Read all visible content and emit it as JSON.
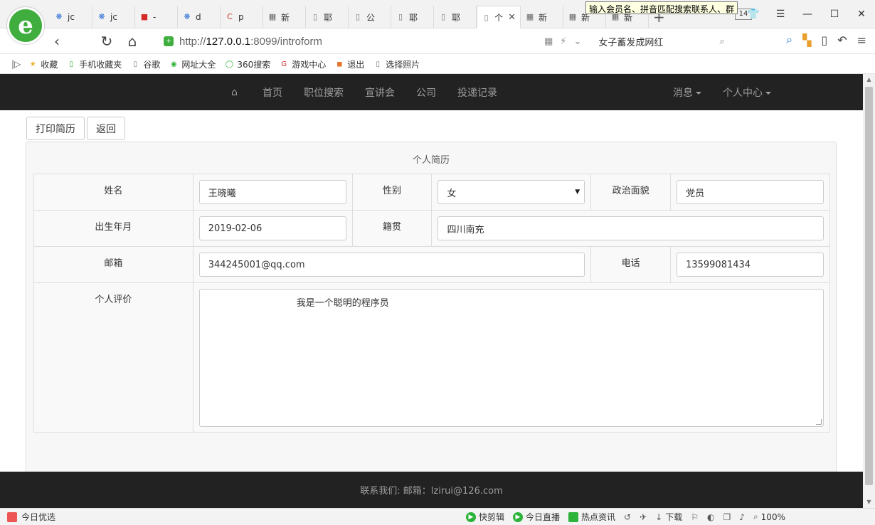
{
  "browser": {
    "logo_letter": "e",
    "tabs": [
      {
        "icon": "baidu-paw",
        "title": "jc"
      },
      {
        "icon": "baidu-paw",
        "title": "jc"
      },
      {
        "icon": "flag",
        "title": "-"
      },
      {
        "icon": "baidu-paw",
        "title": "d"
      },
      {
        "icon": "c-logo",
        "title": "p"
      },
      {
        "icon": "grid",
        "title": "新"
      },
      {
        "icon": "page",
        "title": "耶"
      },
      {
        "icon": "page",
        "title": "公"
      },
      {
        "icon": "page",
        "title": "耶"
      },
      {
        "icon": "page",
        "title": "耶"
      },
      {
        "icon": "page",
        "title": "个",
        "active": true
      },
      {
        "icon": "grid",
        "title": "新"
      },
      {
        "icon": "grid",
        "title": "新"
      },
      {
        "icon": "grid",
        "title": "新"
      }
    ],
    "tooltip": "输入会员名、拼音匹配搜索联系人、群",
    "tab_count": "14",
    "url_prefix": "http://",
    "url_host": "127.0.0.1",
    "url_rest": ":8099/introform",
    "search_text": "女子蓄发成网红",
    "bookmarks": [
      "收藏",
      "手机收藏夹",
      "谷歌",
      "网址大全",
      "360搜索",
      "游戏中心",
      "退出",
      "选择照片"
    ]
  },
  "navbar": {
    "items": [
      "首页",
      "职位搜索",
      "宣讲会",
      "公司",
      "投递记录"
    ],
    "messages": "消息",
    "personal_center": "个人中心"
  },
  "buttons": {
    "print": "打印简历",
    "back": "返回"
  },
  "resume": {
    "title": "个人简历",
    "labels": {
      "name": "姓名",
      "gender": "性别",
      "politics": "政治面貌",
      "birth": "出生年月",
      "native": "籍贯",
      "email": "邮箱",
      "phone": "电话",
      "evaluation": "个人评价"
    },
    "values": {
      "name": "王晓曦",
      "gender": "女",
      "politics": "党员",
      "birth": "2019-02-06",
      "native": "四川南充",
      "email": "344245001@qq.com",
      "phone": "13599081434",
      "evaluation": "我是一个聪明的程序员"
    }
  },
  "footer": {
    "text": "联系我们:  邮箱：lzirui@126.com"
  },
  "statusbar": {
    "left": "今日优选",
    "items": [
      "快剪辑",
      "今日直播",
      "热点资讯",
      "下载",
      "100%"
    ]
  },
  "colors": {
    "navbar_bg": "#222222",
    "navbar_text": "#9d9d9d",
    "brand_green": "#3fae3f"
  }
}
